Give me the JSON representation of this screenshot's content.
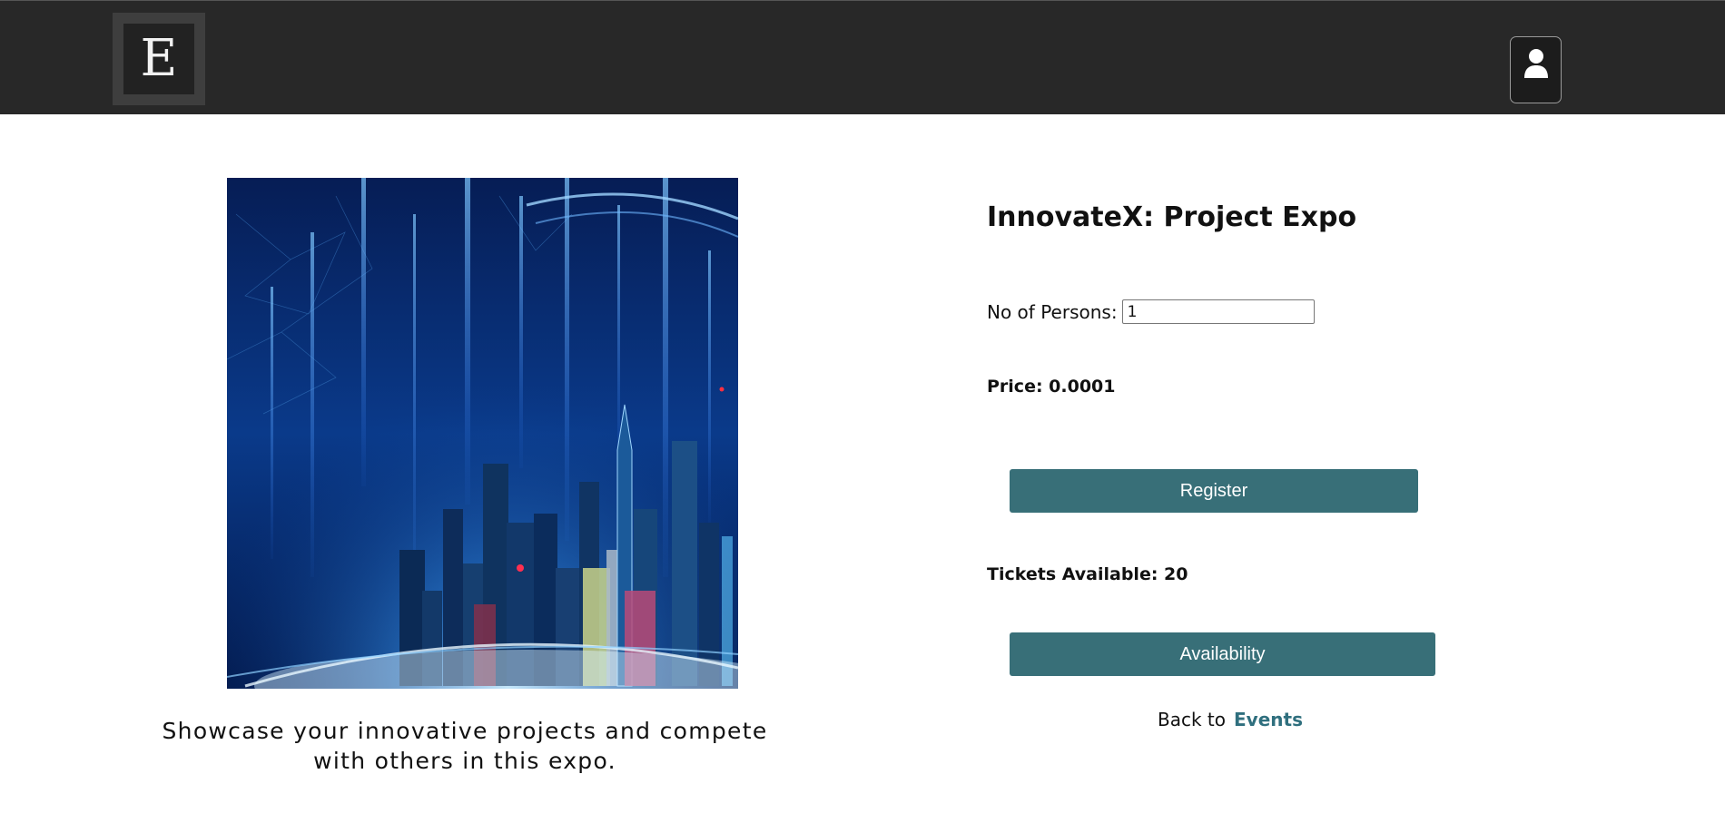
{
  "header": {
    "logo_letter": "E",
    "profile_icon": "user-icon"
  },
  "event": {
    "title": "InnovateX: Project Expo",
    "description": "Showcase your innovative projects and compete with others in this expo.",
    "persons_label": "No of Persons:",
    "persons_value": "1",
    "price_text": "Price: 0.0001",
    "register_label": "Register",
    "tickets_text": "Tickets Available: 20",
    "availability_label": "Availability",
    "back_text": "Back to",
    "events_link": "Events"
  },
  "colors": {
    "navbar": "#282828",
    "button": "#386f78",
    "link": "#2f6f7e"
  }
}
